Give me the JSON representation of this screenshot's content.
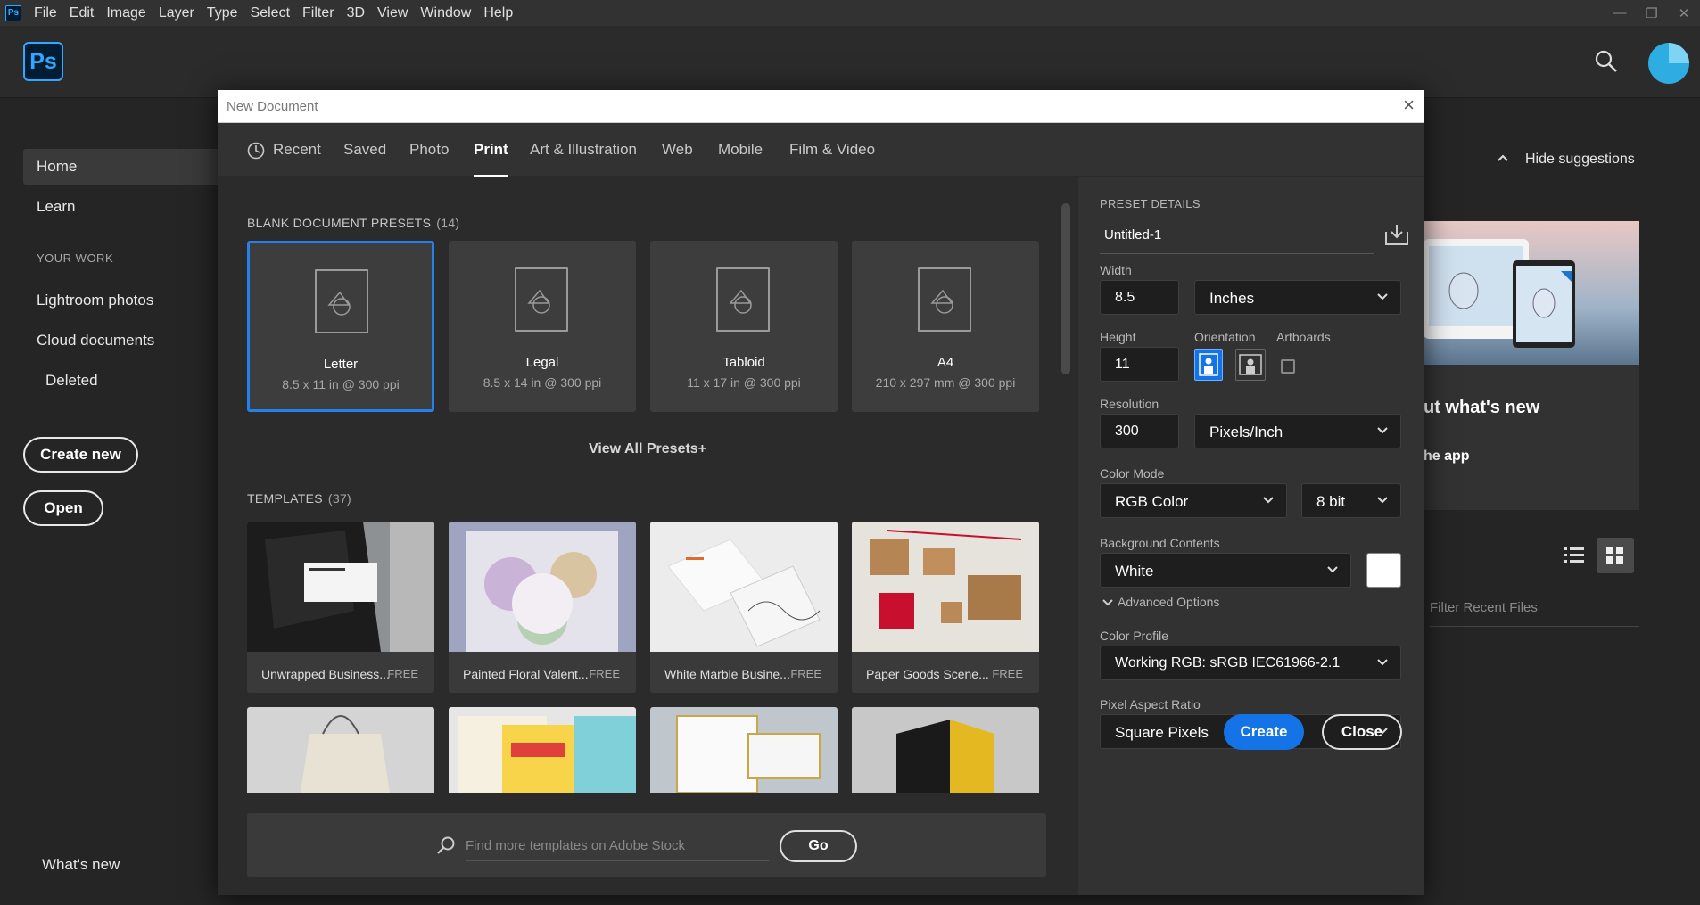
{
  "menubar": {
    "logo": "Ps",
    "items": [
      "File",
      "Edit",
      "Image",
      "Layer",
      "Type",
      "Select",
      "Filter",
      "3D",
      "View",
      "Window",
      "Help"
    ]
  },
  "header": {
    "logo": "Ps"
  },
  "sidebar": {
    "home": "Home",
    "learn": "Learn",
    "your_work": "YOUR WORK",
    "lightroom": "Lightroom photos",
    "cloud": "Cloud documents",
    "deleted": "Deleted",
    "create_new": "Create new",
    "open": "Open",
    "whats_new": "What's new"
  },
  "right_panel": {
    "hide_suggestions": "Hide suggestions",
    "card_title": "ut what's new",
    "card_link": "he app",
    "filter_placeholder": "Filter Recent Files"
  },
  "dialog": {
    "title": "New Document",
    "close_glyph": "×",
    "tabs": [
      "Recent",
      "Saved",
      "Photo",
      "Print",
      "Art & Illustration",
      "Web",
      "Mobile",
      "Film & Video"
    ],
    "active_tab": "Print",
    "blank_presets_label": "BLANK DOCUMENT PRESETS",
    "blank_presets_count": "(14)",
    "presets": [
      {
        "name": "Letter",
        "size": "8.5 x 11 in @ 300 ppi"
      },
      {
        "name": "Legal",
        "size": "8.5 x 14 in @ 300 ppi"
      },
      {
        "name": "Tabloid",
        "size": "11 x 17 in @ 300 ppi"
      },
      {
        "name": "A4",
        "size": "210 x 297 mm @ 300 ppi"
      }
    ],
    "view_all": "View All Presets+",
    "templates_label": "TEMPLATES",
    "templates_count": "(37)",
    "templates": [
      {
        "name": "Unwrapped Business...",
        "price": "FREE"
      },
      {
        "name": "Painted Floral Valent...",
        "price": "FREE"
      },
      {
        "name": "White Marble Busine...",
        "price": "FREE"
      },
      {
        "name": "Paper Goods Scene...",
        "price": "FREE"
      }
    ],
    "stock_placeholder": "Find more templates on Adobe Stock",
    "go": "Go"
  },
  "preset_details": {
    "header": "PRESET DETAILS",
    "doc_name": "Untitled-1",
    "width_label": "Width",
    "width_value": "8.5",
    "width_unit": "Inches",
    "height_label": "Height",
    "height_value": "11",
    "orientation_label": "Orientation",
    "artboards_label": "Artboards",
    "resolution_label": "Resolution",
    "resolution_value": "300",
    "resolution_unit": "Pixels/Inch",
    "color_mode_label": "Color Mode",
    "color_mode": "RGB Color",
    "bit_depth": "8 bit",
    "bg_label": "Background Contents",
    "bg_value": "White",
    "advanced": "Advanced Options",
    "profile_label": "Color Profile",
    "profile_value": "Working RGB: sRGB IEC61966-2.1",
    "par_label": "Pixel Aspect Ratio",
    "par_value": "Square Pixels",
    "create": "Create",
    "close": "Close"
  },
  "colors": {
    "accent": "#1473e6",
    "selection": "#2680eb",
    "ps_blue": "#31a8ff"
  }
}
